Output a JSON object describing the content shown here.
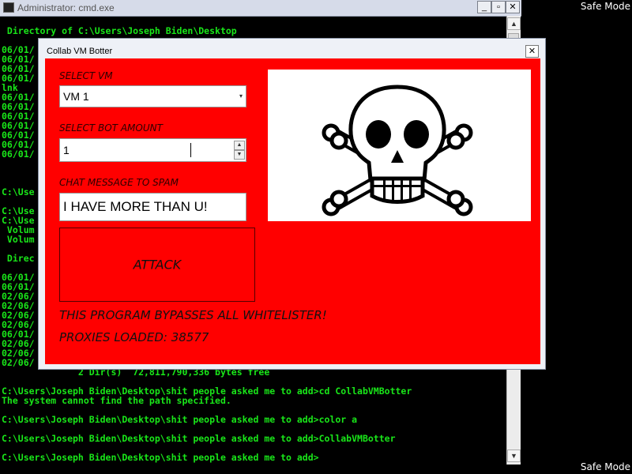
{
  "desktop": {
    "safe_mode_label": "Safe Mode"
  },
  "cmd": {
    "title": "Administrator: cmd.exe",
    "buttons": {
      "minimize": "_",
      "maximize": "▫",
      "close": "✕"
    },
    "scroll_up": "▲",
    "scroll_down": "▼",
    "lines": [
      " Directory of C:\\Users\\Joseph Biden\\Desktop",
      "06/01/",
      "06/01/",
      "06/01/",
      "06/01/",
      "lnk",
      "06/01/",
      "06/01/",
      "06/01/",
      "06/01/",
      "06/01/",
      "06/01/",
      "06/01/",
      "C:\\Use",
      "C:\\Use",
      "C:\\Use",
      " Volum",
      " Volum",
      " Direc",
      "06/01/",
      "06/01/",
      "02/06/",
      "02/06/",
      "02/06/",
      "02/06/",
      "06/01/",
      "02/06/",
      "02/06/",
      "02/06/",
      "              2 Dir(s)  72,811,790,336 bytes free",
      "C:\\Users\\Joseph Biden\\Desktop\\shit people asked me to add>cd CollabVMBotter",
      "The system cannot find the path specified.",
      "C:\\Users\\Joseph Biden\\Desktop\\shit people asked me to add>color a",
      "C:\\Users\\Joseph Biden\\Desktop\\shit people asked me to add>CollabVMBotter",
      "C:\\Users\\Joseph Biden\\Desktop\\shit people asked me to add>"
    ]
  },
  "botter": {
    "title": "Collab VM Botter",
    "close": "✕",
    "select_vm_label": "SELECT VM",
    "select_vm_value": "VM 1",
    "dropdown_arrow": "▾",
    "bot_amount_label": "SELECT BOT AMOUNT",
    "bot_amount_value": "1",
    "spin_up": "▲",
    "spin_down": "▼",
    "chat_label": "CHAT MESSAGE TO SPAM",
    "chat_value": "I HAVE MORE THAN U!",
    "attack_label": "ATTACK",
    "bypass_text": "THIS PROGRAM BYPASSES ALL WHITELISTER!",
    "proxies_text": "PROXIES LOADED: 38577",
    "image_icon": "skull-and-crossbones-icon",
    "accent_color": "#ff0000"
  }
}
